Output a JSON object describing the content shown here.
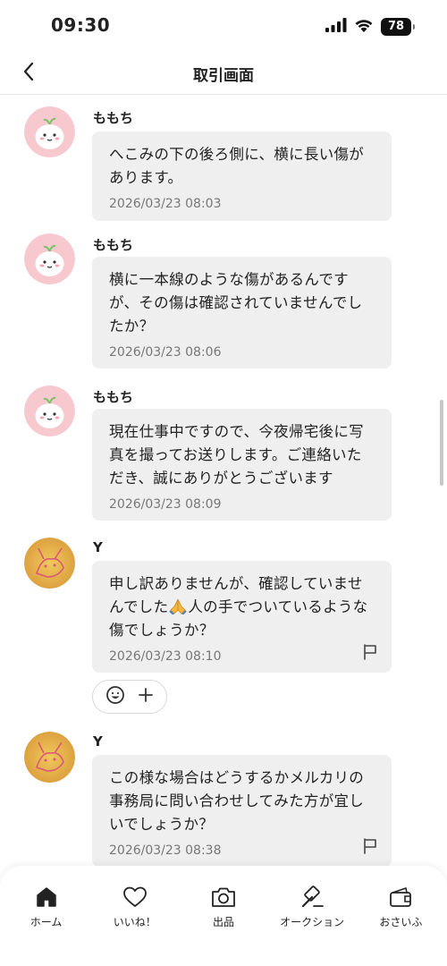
{
  "status_bar": {
    "time": "09:30",
    "battery": "78",
    "icons": [
      "signal-icon",
      "wifi-icon",
      "battery-icon"
    ]
  },
  "nav": {
    "title": "取引画面",
    "back_icon": "chevron-left-icon"
  },
  "messages": [
    {
      "sender": "ももち",
      "avatar": "cartoon-avatar",
      "text": "へこみの下の後ろ側に、横に長い傷があります。",
      "time": "2026/03/23 08:03"
    },
    {
      "sender": "ももち",
      "avatar": "cartoon-avatar",
      "text": "横に一本線のような傷があるんですが、その傷は確認されていませんでしたか？",
      "time": "2026/03/23 08:06"
    },
    {
      "sender": "ももち",
      "avatar": "cartoon-avatar",
      "text": "現在仕事中ですので、今夜帰宅後に写真を撮ってお送りします。ご連絡いただき、誠にありがとうございます",
      "time": "2026/03/23 08:09"
    },
    {
      "sender": "Y",
      "avatar": "yellow-character-avatar",
      "text_before_emoji": "申し訳ありませんが、確認していませんでした",
      "text_after_emoji": "人の手でついているような傷でしょうか？",
      "emoji": "folded-hands-emoji",
      "time": "2026/03/23 08:10",
      "flag_icon": "flag-icon",
      "reaction_icons": [
        "smiley-icon",
        "plus-icon"
      ]
    },
    {
      "sender": "Y",
      "avatar": "yellow-character-avatar",
      "text": "この様な場合はどうするかメルカリの事務局に問い合わせしてみた方が宜しいでしょうか？",
      "time": "2026/03/23 08:38",
      "flag_icon": "flag-icon"
    }
  ],
  "tab_bar": [
    {
      "label": "ホーム",
      "icon": "home-icon"
    },
    {
      "label": "いいね！",
      "icon": "heart-icon"
    },
    {
      "label": "出品",
      "icon": "camera-icon"
    },
    {
      "label": "オークション",
      "icon": "gavel-icon"
    },
    {
      "label": "おさいふ",
      "icon": "wallet-icon"
    }
  ],
  "colors": {
    "bubble": "#efefef",
    "text": "#222222",
    "timestamp": "#777777",
    "avatar_pink": "#f7c9cf",
    "avatar_yellow": "#e8b84a"
  }
}
